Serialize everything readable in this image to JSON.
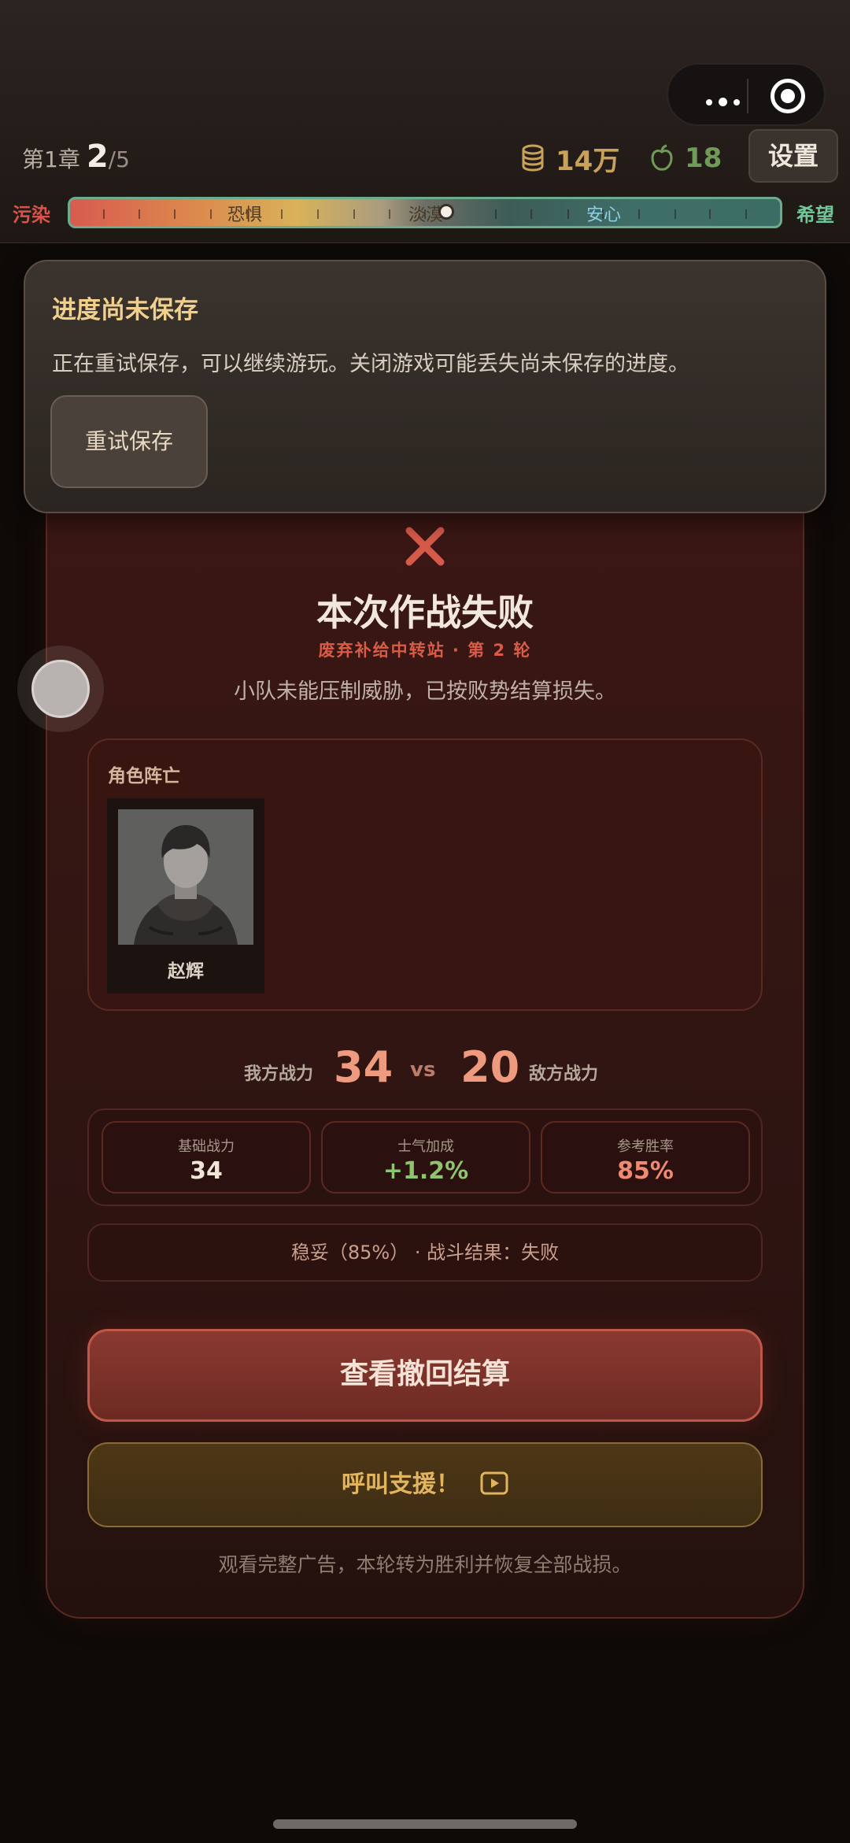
{
  "header": {
    "chapter_label": "第1章",
    "stage_current": "2",
    "stage_total": "/5",
    "coins": "14万",
    "apples": "18",
    "settings_label": "设置"
  },
  "meter": {
    "left_label": "污染",
    "right_label": "希望",
    "zones": [
      "恐惧",
      "淡漠",
      "安心"
    ],
    "level": 0.53
  },
  "toast": {
    "title": "进度尚未保存",
    "desc": "正在重试保存，可以继续游玩。关闭游戏可能丢失尚未保存的进度。",
    "retry_label": "重试保存"
  },
  "result": {
    "title": "本次作战失败",
    "subtitle": "废弃补给中转站 · 第 2 轮",
    "desc": "小队未能压制威胁，已按败势结算损失。",
    "fallen_label": "角色阵亡",
    "fallen_name": "赵辉",
    "my_power_label": "我方战力",
    "my_power": "34",
    "vs": "vs",
    "enemy_power": "20",
    "enemy_power_label": "敌方战力",
    "stats": [
      {
        "label": "基础战力",
        "value": "34",
        "color": "#f0e6d8"
      },
      {
        "label": "士气加成",
        "value": "+1.2%",
        "color": "#8ec46e"
      },
      {
        "label": "参考胜率",
        "value": "85%",
        "color": "#ee8a72"
      }
    ],
    "verdict": "稳妥（85%） · 战斗结果：失败",
    "retreat_label": "查看撤回结算",
    "support_label": "呼叫支援！",
    "ad_note": "观看完整广告，本轮转为胜利并恢复全部战损。"
  },
  "colors": {
    "accent_red": "#d85c47",
    "gold": "#c9a25a",
    "green": "#6f9a58"
  }
}
